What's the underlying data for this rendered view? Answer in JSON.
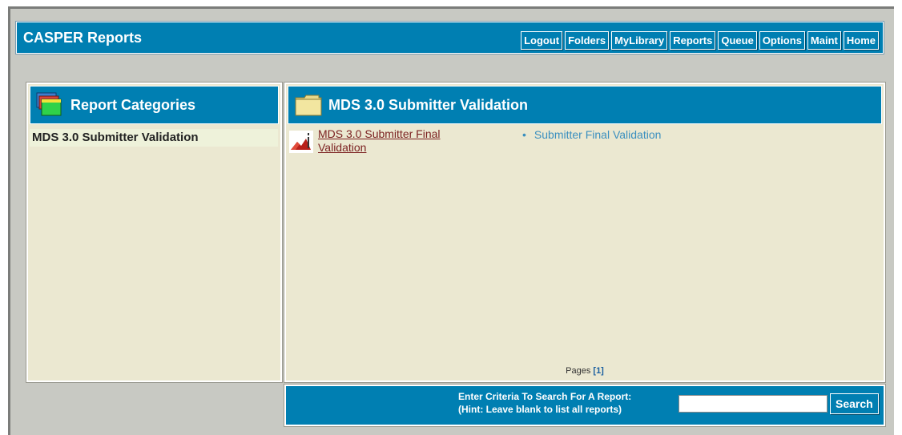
{
  "app": {
    "title": "CASPER Reports"
  },
  "nav": [
    {
      "label": "Logout"
    },
    {
      "label": "Folders"
    },
    {
      "label": "MyLibrary"
    },
    {
      "label": "Reports"
    },
    {
      "label": "Queue"
    },
    {
      "label": "Options"
    },
    {
      "label": "Maint"
    },
    {
      "label": "Home"
    }
  ],
  "left_panel": {
    "title": "Report Categories",
    "icon": "folder-stack-icon",
    "items": [
      {
        "label": "MDS 3.0 Submitter Validation"
      }
    ]
  },
  "right_panel": {
    "title": "MDS 3.0 Submitter Validation",
    "icon": "folder-icon",
    "reports": [
      {
        "icon": "report-icon",
        "name": "MDS 3.0 Submitter Final Validation",
        "description": "Submitter Final Validation"
      }
    ],
    "pages_label": "Pages",
    "pages": "[1]"
  },
  "search": {
    "line1": "Enter Criteria To Search For A Report:",
    "line2": "(Hint: Leave blank to list all reports)",
    "value": "",
    "button": "Search"
  },
  "colors": {
    "header_blue": "#007fb2",
    "panel_bg": "#ebe8d1",
    "frame_bg": "#c8c9c3",
    "link": "#7a1f1f",
    "description": "#3a8fbf"
  }
}
